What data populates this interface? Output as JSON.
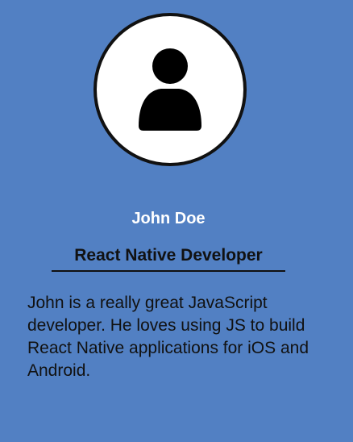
{
  "profile": {
    "avatar_icon": "user-silhouette-icon",
    "name": "John Doe",
    "role": "React Native Developer",
    "bio": "John is a really great JavaScript developer. He loves using JS to build React Native applications for iOS and Android."
  },
  "colors": {
    "background": "#5280c3",
    "name_text": "#ffffff",
    "text": "#111111",
    "avatar_bg": "#ffffff"
  }
}
